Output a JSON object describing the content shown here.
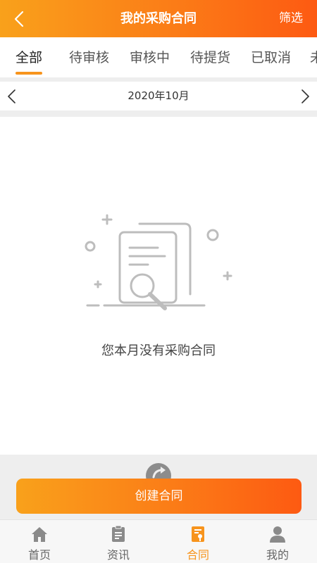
{
  "header": {
    "title": "我的采购合同",
    "filter_label": "筛选",
    "colors": {
      "gradient_start": "#f9a11b",
      "gradient_end": "#fd5a12"
    }
  },
  "tabs": [
    {
      "label": "全部",
      "active": true
    },
    {
      "label": "待审核",
      "active": false
    },
    {
      "label": "审核中",
      "active": false
    },
    {
      "label": "待提货",
      "active": false
    },
    {
      "label": "已取消",
      "active": false
    },
    {
      "label": "未",
      "active": false
    }
  ],
  "month_bar": {
    "label": "2020年10月",
    "prev_icon": "chevron-left-icon",
    "next_icon": "chevron-right-icon"
  },
  "empty_state": {
    "icon": "empty-document-search-icon",
    "message": "您本月没有采购合同"
  },
  "create_button": {
    "label": "创建合同"
  },
  "bottom_nav": [
    {
      "label": "首页",
      "icon": "home-icon",
      "active": false
    },
    {
      "label": "资讯",
      "icon": "news-icon",
      "active": false
    },
    {
      "label": "合同",
      "icon": "contract-icon",
      "active": true
    },
    {
      "label": "我的",
      "icon": "user-icon",
      "active": false
    }
  ],
  "accent_color": "#f7941d"
}
